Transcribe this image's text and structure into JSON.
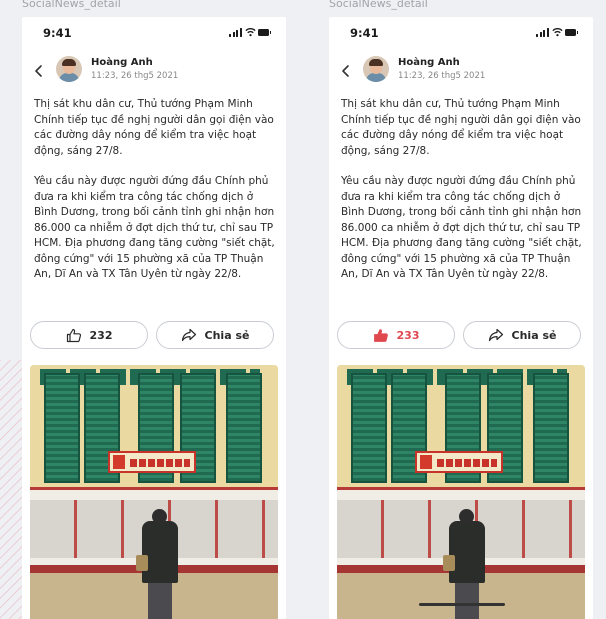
{
  "frames": [
    {
      "label": "SocialNews_detail",
      "status_time": "9:41",
      "author": "Hoàng Anh",
      "post_time": "11:23, 26 thg5 2021",
      "paragraphs": [
        "Thị sát khu dân cư, Thủ tướng Phạm Minh Chính tiếp tục đề nghị người dân gọi điện vào các đường dây nóng để kiểm tra việc hoạt động, sáng 27/8.",
        "Yêu cầu này được người đứng đầu Chính phủ đưa ra khi kiểm tra công tác chống dịch ở Bình Dương, trong bối cảnh tỉnh ghi nhận hơn 86.000 ca nhiễm ở đợt dịch thứ tư, chỉ sau TP HCM. Địa phương đang tăng cường \"siết chặt, đông cứng\" với 15 phường xã của TP Thuận An, Dĩ An và TX Tân Uyên từ ngày 22/8."
      ],
      "like_count": "232",
      "liked": false,
      "share_label": "Chia sẻ"
    },
    {
      "label": "SocialNews_detail",
      "status_time": "9:41",
      "author": "Hoàng Anh",
      "post_time": "11:23, 26 thg5 2021",
      "paragraphs": [
        "Thị sát khu dân cư, Thủ tướng Phạm Minh Chính tiếp tục đề nghị người dân gọi điện vào các đường dây nóng để kiểm tra việc hoạt động, sáng 27/8.",
        "Yêu cầu này được người đứng đầu Chính phủ đưa ra khi kiểm tra công tác chống dịch ở Bình Dương, trong bối cảnh tỉnh ghi nhận hơn 86.000 ca nhiễm ở đợt dịch thứ tư, chỉ sau TP HCM. Địa phương đang tăng cường \"siết chặt, đông cứng\" với 15 phường xã của TP Thuận An, Dĩ An và TX Tân Uyên từ ngày 22/8."
      ],
      "like_count": "233",
      "liked": true,
      "share_label": "Chia sẻ"
    }
  ],
  "icons": {
    "back": "chevron-left-icon",
    "like": "thumbs-up-icon",
    "share": "share-arrow-icon"
  },
  "colors": {
    "liked": "#e0484f",
    "text": "#2a2a2a",
    "muted": "#888888",
    "button_border": "#c9cdd3"
  },
  "image": {
    "signboard_text": "Hanoimoi"
  }
}
